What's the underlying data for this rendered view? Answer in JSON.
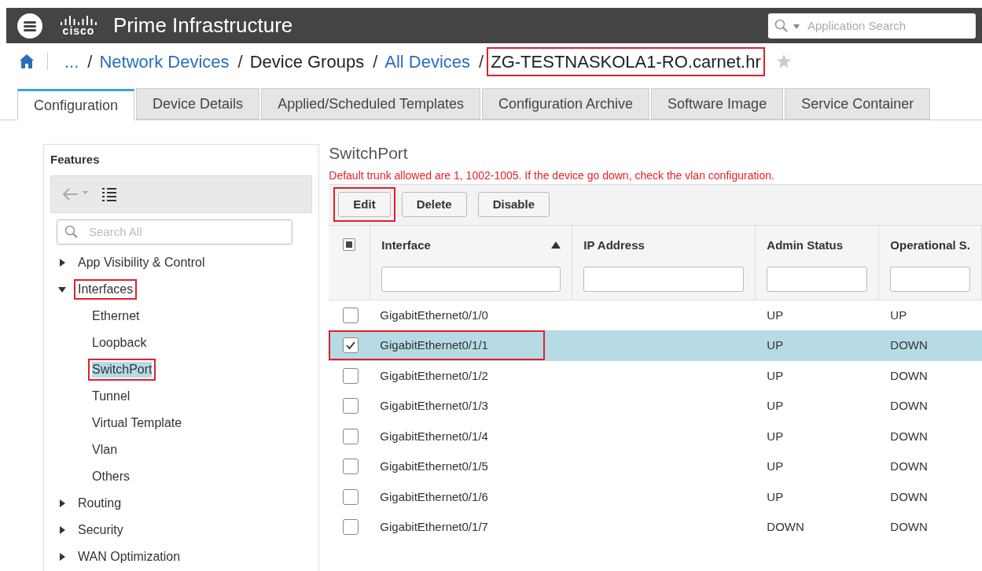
{
  "header": {
    "brand": "Prime Infrastructure",
    "logo_word": "cisco",
    "search": {
      "placeholder": "Application Search"
    }
  },
  "breadcrumb": [
    {
      "text": "...",
      "link": true,
      "annotated": false
    },
    {
      "separator": "/",
      "text": "Network Devices",
      "link": true,
      "annotated": false
    },
    {
      "separator": "/",
      "text": "Device Groups",
      "link": false,
      "annotated": false
    },
    {
      "separator": "/",
      "text": "All Devices",
      "link": true,
      "annotated": false
    },
    {
      "separator": "/",
      "text": "ZG-TESTNASKOLA1-RO.carnet.hr",
      "link": false,
      "annotated": true
    }
  ],
  "tabs": [
    {
      "label": "Configuration",
      "selected": true
    },
    {
      "label": "Device Details",
      "selected": false
    },
    {
      "label": "Applied/Scheduled Templates",
      "selected": false
    },
    {
      "label": "Configuration Archive",
      "selected": false
    },
    {
      "label": "Software Image",
      "selected": false
    },
    {
      "label": "Service Container",
      "selected": false
    }
  ],
  "sidebar": {
    "title": "Features",
    "search": {
      "placeholder": "Search All"
    },
    "items": [
      {
        "label": "App Visibility & Control",
        "expanded": false,
        "annotated": false
      },
      {
        "label": "Interfaces",
        "expanded": true,
        "annotated": true,
        "children": [
          {
            "label": "Ethernet",
            "selected": false,
            "annotated": false
          },
          {
            "label": "Loopback",
            "selected": false,
            "annotated": false
          },
          {
            "label": "SwitchPort",
            "selected": true,
            "annotated": true
          },
          {
            "label": "Tunnel",
            "selected": false,
            "annotated": false
          },
          {
            "label": "Virtual Template",
            "selected": false,
            "annotated": false
          },
          {
            "label": "Vlan",
            "selected": false,
            "annotated": false
          },
          {
            "label": "Others",
            "selected": false,
            "annotated": false
          }
        ]
      },
      {
        "label": "Routing",
        "expanded": false,
        "annotated": false
      },
      {
        "label": "Security",
        "expanded": false,
        "annotated": false
      },
      {
        "label": "WAN Optimization",
        "expanded": false,
        "annotated": false
      }
    ]
  },
  "content": {
    "title": "SwitchPort",
    "warning": "Default trunk allowed are 1, 1002-1005. If the device go down, check the vlan configuration.",
    "buttons": [
      {
        "label": "Edit",
        "annotated": true
      },
      {
        "label": "Delete",
        "annotated": false
      },
      {
        "label": "Disable",
        "annotated": false
      }
    ],
    "table": {
      "select_all_indeterminate": true,
      "columns": [
        "Interface",
        "IP Address",
        "Admin Status",
        "Operational S."
      ],
      "rows": [
        {
          "interface": "GigabitEthernet0/1/0",
          "admin": "UP",
          "oper": "UP",
          "selected": false,
          "annotated": false
        },
        {
          "interface": "GigabitEthernet0/1/1",
          "admin": "UP",
          "oper": "DOWN",
          "selected": true,
          "annotated": true
        },
        {
          "interface": "GigabitEthernet0/1/2",
          "admin": "UP",
          "oper": "DOWN",
          "selected": false,
          "annotated": false
        },
        {
          "interface": "GigabitEthernet0/1/3",
          "admin": "UP",
          "oper": "DOWN",
          "selected": false,
          "annotated": false
        },
        {
          "interface": "GigabitEthernet0/1/4",
          "admin": "UP",
          "oper": "DOWN",
          "selected": false,
          "annotated": false
        },
        {
          "interface": "GigabitEthernet0/1/5",
          "admin": "UP",
          "oper": "DOWN",
          "selected": false,
          "annotated": false
        },
        {
          "interface": "GigabitEthernet0/1/6",
          "admin": "UP",
          "oper": "DOWN",
          "selected": false,
          "annotated": false
        },
        {
          "interface": "GigabitEthernet0/1/7",
          "admin": "DOWN",
          "oper": "DOWN",
          "selected": false,
          "annotated": false
        }
      ]
    }
  }
}
